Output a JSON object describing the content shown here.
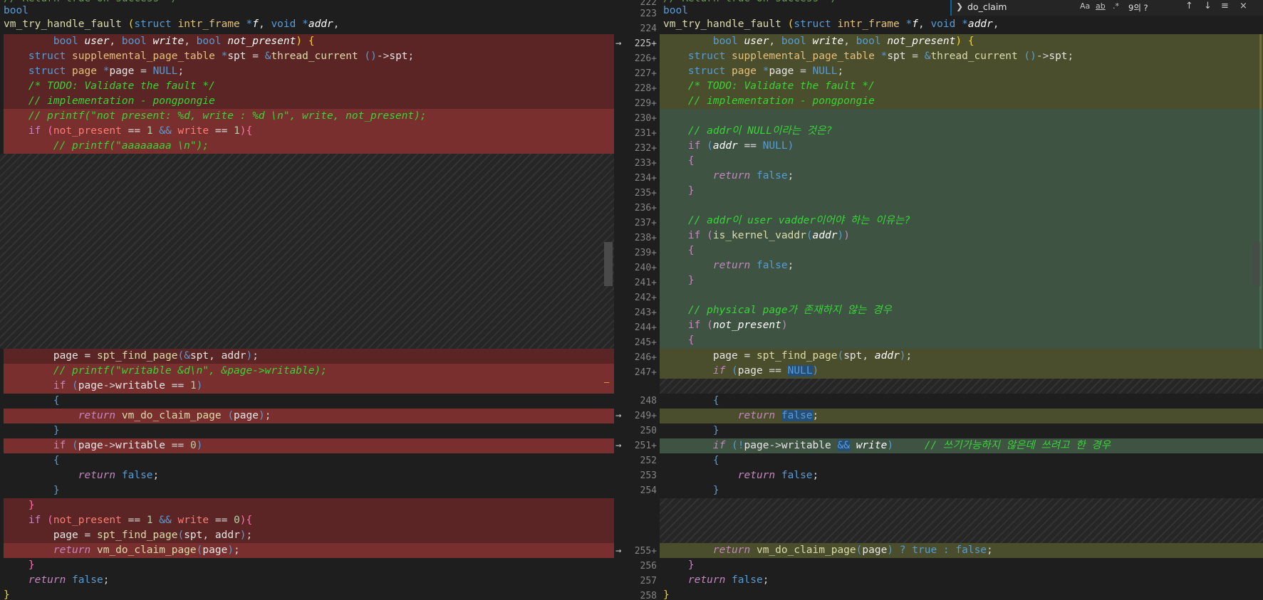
{
  "find_widget": {
    "query": "do_claim",
    "match_case": "Aa",
    "whole_word": "ab",
    "regex": ".*",
    "result_count": "9의 ?",
    "prev": "↑",
    "next": "↓",
    "in_selection": "≡",
    "close": "×"
  },
  "gutter_numbers": {
    "l223": "223",
    "l224": "224",
    "l225": "225+",
    "l226": "226+",
    "l227": "227+",
    "l228": "228+",
    "l229": "229+",
    "l230": "230+",
    "l231": "231+",
    "l232": "232+",
    "l233": "233+",
    "l234": "234+",
    "l235": "235+",
    "l236": "236+",
    "l237": "237+",
    "l238": "238+",
    "l239": "239+",
    "l240": "240+",
    "l241": "241+",
    "l242": "242+",
    "l243": "243+",
    "l244": "244+",
    "l245": "245+",
    "l246": "246+",
    "l247": "247+",
    "l248": "248",
    "l249": "249+",
    "l250": "250",
    "l251": "251+",
    "l252": "252",
    "l253": "253",
    "l254": "254",
    "l255": "255+",
    "l256": "256",
    "l257": "257",
    "l258": "258"
  },
  "arrow": "→",
  "left": {
    "bool": "bool",
    "fn_name": "vm_try_handle_fault",
    "struct_kw": "struct",
    "intr_frame": "intr_frame",
    "void_kw": "void",
    "bool_kw": "bool",
    "user": "user",
    "write": "write",
    "not_present": "not_present",
    "spt_type": "supplemental_page_table",
    "spt": "spt",
    "thread_current": "thread_current",
    "page_type": "page",
    "null": "NULL",
    "todo_comment": "/* TODO: Validate the fault */",
    "impl_comment": "// implementation - pongpongie",
    "printf1": "// printf(\"not present: %d, write : %d \\n\", write, not_present);",
    "printf2": "// printf(\"aaaaaaaa \\n\");",
    "printf3": "// printf(\"writable &d\\n\", &page->writable);",
    "find_page": "spt_find_page",
    "claim": "vm_do_claim_page",
    "return_kw": "return",
    "false_kw": "false",
    "if_kw": "if"
  },
  "right": {
    "comment_null": "// addr이 NULL이라는 것은?",
    "comment_user": "// addr이 user vadder이어야 하는 이유는?",
    "comment_physical": "// physical page가 존재하지 않는 경우",
    "comment_write": "// 쓰기가능하지 않은데 쓰려고 한 경우",
    "is_kernel_vaddr": "is_kernel_vaddr",
    "true_kw": "true"
  }
}
